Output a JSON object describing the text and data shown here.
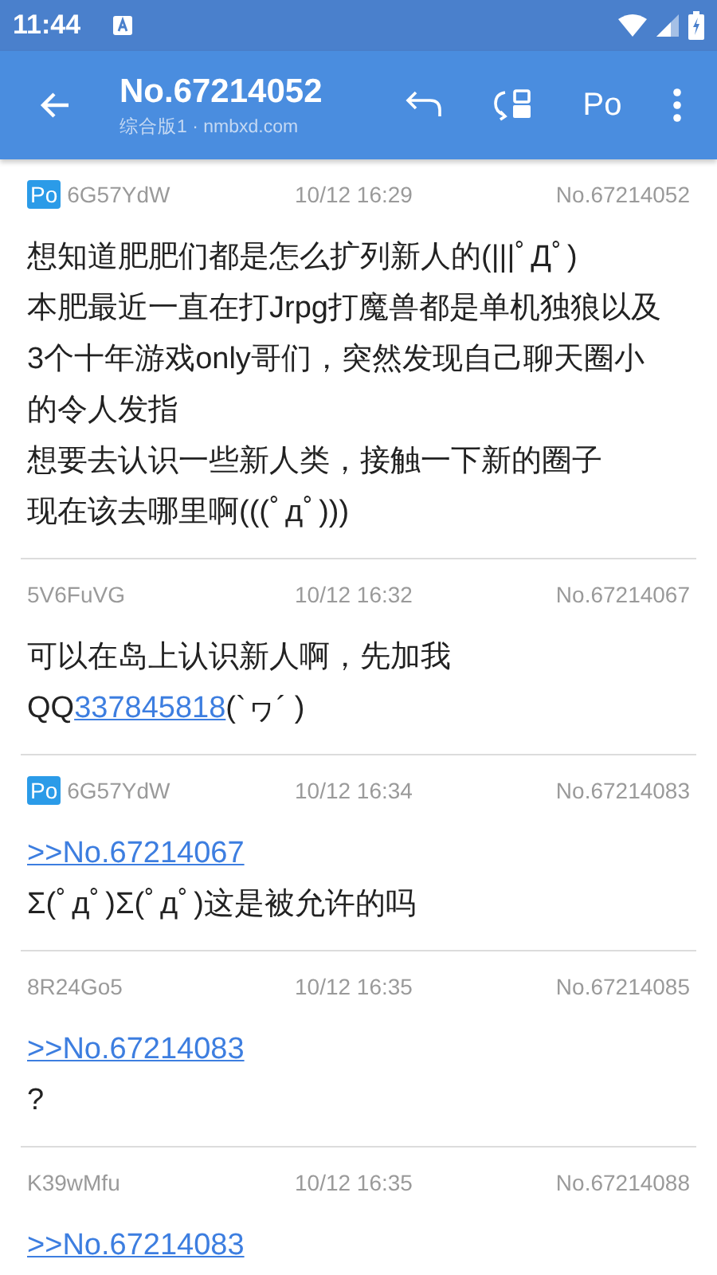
{
  "status_bar": {
    "time": "11:44"
  },
  "app_bar": {
    "title": "No.67214052",
    "subtitle": "综合版1 · nmbxd.com",
    "po_label": "Po"
  },
  "posts": [
    {
      "po": true,
      "po_badge": "Po",
      "user": "6G57YdW",
      "time": "10/12 16:29",
      "number": "No.67214052",
      "lines": [
        {
          "kind": "text",
          "segments": [
            {
              "text": "想知道肥肥们都是怎么扩列新人的(|||ﾟДﾟ)",
              "link": false
            }
          ]
        },
        {
          "kind": "text",
          "segments": [
            {
              "text": "本肥最近一直在打Jrpg打魔兽都是单机独狼以及3个十年游戏only哥们，突然发现自己聊天圈小的令人发指",
              "link": false
            }
          ]
        },
        {
          "kind": "text",
          "segments": [
            {
              "text": "想要去认识一些新人类，接触一下新的圈子",
              "link": false
            }
          ]
        },
        {
          "kind": "text",
          "segments": [
            {
              "text": "现在该去哪里啊(((ﾟдﾟ)))",
              "link": false
            }
          ]
        }
      ]
    },
    {
      "po": false,
      "user": "5V6FuVG",
      "time": "10/12 16:32",
      "number": "No.67214067",
      "lines": [
        {
          "kind": "text",
          "segments": [
            {
              "text": "可以在岛上认识新人啊，先加我",
              "link": false
            }
          ]
        },
        {
          "kind": "text",
          "segments": [
            {
              "text": "QQ",
              "link": false
            },
            {
              "text": "337845818",
              "link": true
            },
            {
              "text": "(`ヮ´ )",
              "link": false
            }
          ]
        }
      ]
    },
    {
      "po": true,
      "po_badge": "Po",
      "user": "6G57YdW",
      "time": "10/12 16:34",
      "number": "No.67214083",
      "lines": [
        {
          "kind": "quote",
          "text": ">>No.67214067"
        },
        {
          "kind": "text",
          "segments": [
            {
              "text": "Σ(ﾟдﾟ)Σ(ﾟдﾟ)这是被允许的吗",
              "link": false
            }
          ]
        }
      ]
    },
    {
      "po": false,
      "user": "8R24Go5",
      "time": "10/12 16:35",
      "number": "No.67214085",
      "lines": [
        {
          "kind": "quote",
          "text": ">>No.67214083"
        },
        {
          "kind": "text",
          "segments": [
            {
              "text": "?",
              "link": false
            }
          ]
        }
      ]
    },
    {
      "po": false,
      "user": "K39wMfu",
      "time": "10/12 16:35",
      "number": "No.67214088",
      "lines": [
        {
          "kind": "quote",
          "text": ">>No.67214083"
        }
      ]
    }
  ]
}
